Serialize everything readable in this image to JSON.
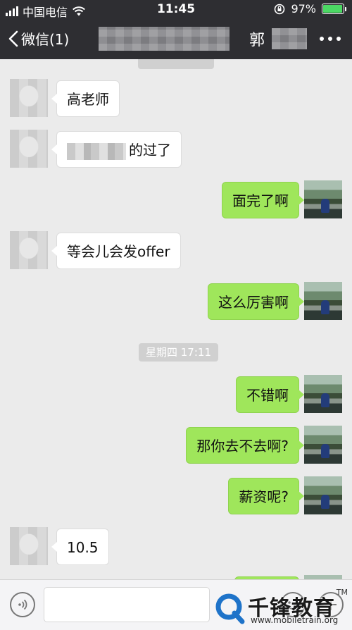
{
  "status_bar": {
    "carrier": "中国电信",
    "time": "11:45",
    "battery_text": "97%",
    "battery_level": 0.97,
    "battery_color": "#4cd964",
    "icons": [
      "signal-icon",
      "wifi-icon",
      "orientation-lock-icon",
      "battery-icon"
    ]
  },
  "nav": {
    "back_label": "微信(1)",
    "title": "郭",
    "icons": [
      "back-chevron-icon",
      "more-icon"
    ]
  },
  "chat": {
    "timestamps": [
      "星期四 17:11"
    ],
    "messages": [
      {
        "side": "left",
        "text": "高老师"
      },
      {
        "side": "left",
        "text": "的过了",
        "partially_obscured": true
      },
      {
        "side": "right",
        "text": "面完了啊"
      },
      {
        "side": "left",
        "text": "等会儿会发offer"
      },
      {
        "side": "right",
        "text": "这么厉害啊"
      },
      {
        "side": "right",
        "text": "不错啊"
      },
      {
        "side": "right",
        "text": "那你去不去啊?"
      },
      {
        "side": "right",
        "text": "薪资呢?"
      },
      {
        "side": "left",
        "text": "10.5"
      }
    ],
    "colors": {
      "background": "#ebebeb",
      "sent_bubble": "#9fe65b",
      "received_bubble": "#ffffff"
    }
  },
  "input_bar": {
    "icons": [
      "voice-icon",
      "emoji-icon",
      "plus-icon"
    ]
  },
  "watermark": {
    "brand": "千锋教育",
    "url": "www.mobiletrain.org",
    "tm": "TM"
  }
}
